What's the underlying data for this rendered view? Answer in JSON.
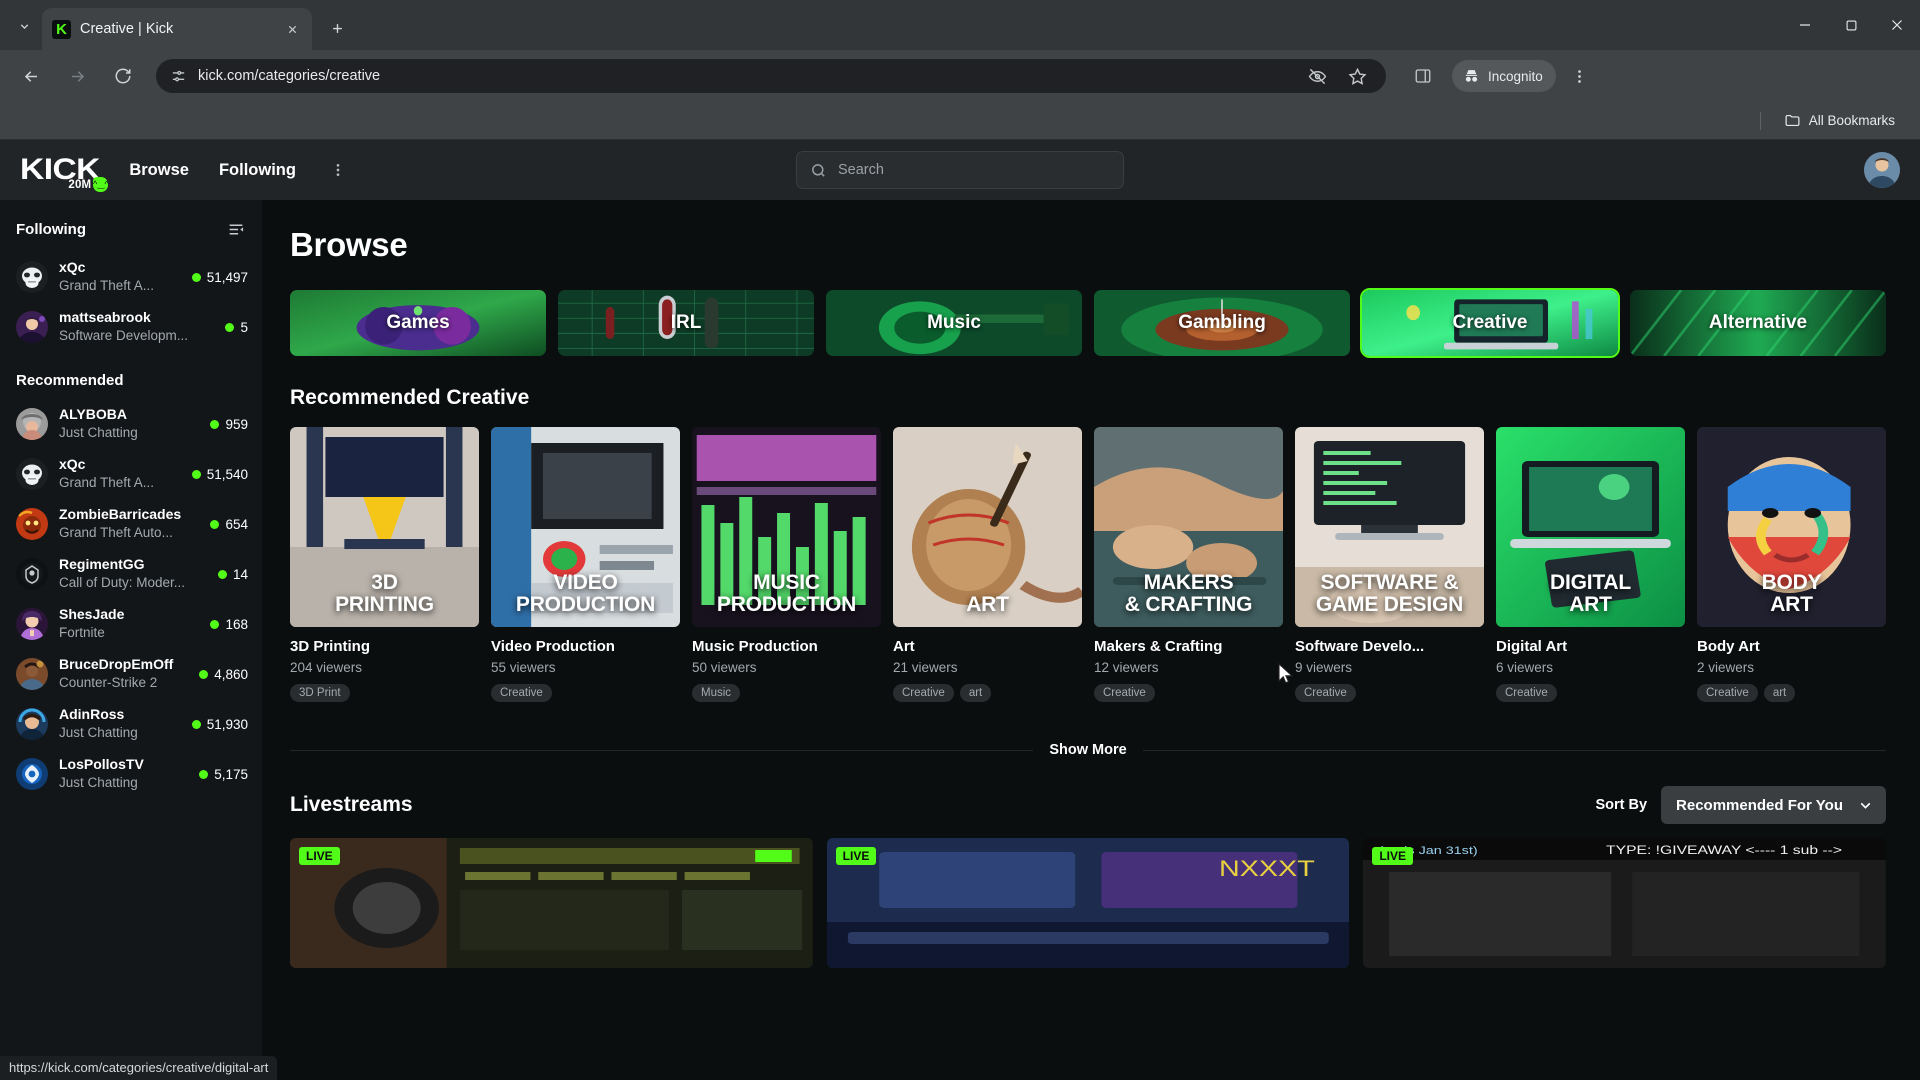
{
  "browser": {
    "tab": {
      "title": "Creative | Kick",
      "favicon_letter": "K",
      "favicon_name": "kick-favicon"
    },
    "new_tab_label": "+",
    "tab_search_icon": "chevron-down-icon",
    "window": {
      "minimize": "—",
      "maximize": "❐",
      "close": "✕"
    },
    "nav": {
      "back": "back-icon",
      "forward": "forward-icon",
      "reload": "reload-icon"
    },
    "omnibox": {
      "url": "kick.com/categories/creative",
      "site_icon": "site-settings-icon"
    },
    "toolbar_icons": [
      "third-party-cookie-blocked-icon",
      "bookmark-star-icon",
      "side-panel-icon"
    ],
    "incognito_label": "Incognito",
    "menu_icon": "kebab-menu-icon",
    "bookmarks": {
      "all_bookmarks_label": "All Bookmarks",
      "folder_icon": "folder-icon"
    },
    "status_url": "https://kick.com/categories/creative/digital-art"
  },
  "header": {
    "logo_text": "KICK",
    "logo_badge_text": "20M",
    "nav_links": [
      {
        "label": "Browse",
        "name": "nav-browse"
      },
      {
        "label": "Following",
        "name": "nav-following"
      }
    ],
    "more_icon": "kebab-menu-icon",
    "search": {
      "placeholder": "Search",
      "icon": "search-icon"
    },
    "avatar_name": "user-avatar"
  },
  "sidebar": {
    "following_title": "Following",
    "collapse_icon": "collapse-sidebar-icon",
    "recommended_title": "Recommended",
    "following": [
      {
        "name": "xQc",
        "category": "Grand Theft A...",
        "viewers": "51,497",
        "avatar": "xqc"
      },
      {
        "name": "mattseabrook",
        "category": "Software Developm...",
        "viewers": "5",
        "avatar": "mattseabrook"
      }
    ],
    "recommended": [
      {
        "name": "ALYBOBA",
        "category": "Just Chatting",
        "viewers": "959",
        "avatar": "alyboba"
      },
      {
        "name": "xQc",
        "category": "Grand Theft A...",
        "viewers": "51,540",
        "avatar": "xqc"
      },
      {
        "name": "ZombieBarricades",
        "category": "Grand Theft Auto...",
        "viewers": "654",
        "avatar": "zombie"
      },
      {
        "name": "RegimentGG",
        "category": "Call of Duty: Moder...",
        "viewers": "14",
        "avatar": "regiment"
      },
      {
        "name": "ShesJade",
        "category": "Fortnite",
        "viewers": "168",
        "avatar": "shesjade"
      },
      {
        "name": "BruceDropEmOff",
        "category": "Counter-Strike 2",
        "viewers": "4,860",
        "avatar": "bruce"
      },
      {
        "name": "AdinRoss",
        "category": "Just Chatting",
        "viewers": "51,930",
        "avatar": "adinross"
      },
      {
        "name": "LosPollosTV",
        "category": "Just Chatting",
        "viewers": "5,175",
        "avatar": "lospollos"
      }
    ]
  },
  "main": {
    "page_title": "Browse",
    "categories": [
      {
        "label": "Games",
        "selected": false
      },
      {
        "label": "IRL",
        "selected": false
      },
      {
        "label": "Music",
        "selected": false
      },
      {
        "label": "Gambling",
        "selected": false
      },
      {
        "label": "Creative",
        "selected": true
      },
      {
        "label": "Alternative",
        "selected": false
      }
    ],
    "recommended_heading": "Recommended Creative",
    "cards": [
      {
        "thumb_label": "3D\nPRINTING",
        "title": "3D Printing",
        "viewers": "204 viewers",
        "tags": [
          "3D Print"
        ]
      },
      {
        "thumb_label": "VIDEO\nPRODUCTION",
        "title": "Video Production",
        "viewers": "55 viewers",
        "tags": [
          "Creative"
        ]
      },
      {
        "thumb_label": "MUSIC\nPRODUCTION",
        "title": "Music Production",
        "viewers": "50 viewers",
        "tags": [
          "Music"
        ]
      },
      {
        "thumb_label": "ART",
        "title": "Art",
        "viewers": "21 viewers",
        "tags": [
          "Creative",
          "art"
        ]
      },
      {
        "thumb_label": "MAKERS\n& CRAFTING",
        "title": "Makers & Crafting",
        "viewers": "12 viewers",
        "tags": [
          "Creative"
        ]
      },
      {
        "thumb_label": "SOFTWARE &\nGAME DESIGN",
        "title": "Software Develo...",
        "viewers": "9 viewers",
        "tags": [
          "Creative"
        ]
      },
      {
        "thumb_label": "DIGITAL\nART",
        "title": "Digital Art",
        "viewers": "6 viewers",
        "tags": [
          "Creative"
        ]
      },
      {
        "thumb_label": "BODY\nART",
        "title": "Body Art",
        "viewers": "2 viewers",
        "tags": [
          "Creative",
          "art"
        ]
      }
    ],
    "show_more_label": "Show More",
    "livestreams_heading": "Livestreams",
    "sort_label": "Sort By",
    "sort_value": "Recommended For You",
    "sort_chevron": "chevron-down-icon",
    "livestreams": [
      {
        "live_label": "LIVE"
      },
      {
        "live_label": "LIVE"
      },
      {
        "live_label": "LIVE"
      }
    ]
  },
  "colors": {
    "kick_green": "#53fc18",
    "page_bg": "#0b0e0f",
    "sidebar_bg": "#131619",
    "header_bg": "#222528"
  }
}
